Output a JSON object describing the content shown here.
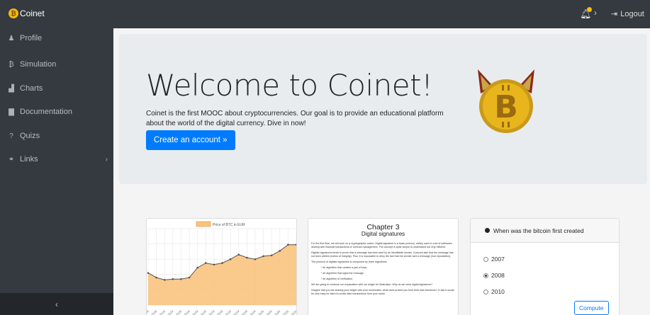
{
  "topbar": {
    "brand": "Coinet",
    "logout_label": "Logout",
    "icons": {
      "brand": "bitcoin-cat-logo",
      "bell": "bell-icon",
      "chevron": "chevron-right-icon",
      "logout": "sign-out-icon"
    },
    "notification_color": "#f2c200"
  },
  "sidebar": {
    "items": [
      {
        "label": "Profile",
        "icon": "user-icon",
        "glyph": "♟"
      },
      {
        "label": "Simulation",
        "icon": "bitcoin-icon",
        "glyph": "₿"
      },
      {
        "label": "Charts",
        "icon": "area-chart-icon",
        "glyph": "▟"
      },
      {
        "label": "Documentation",
        "icon": "file-icon",
        "glyph": "▇"
      },
      {
        "label": "Quizs",
        "icon": "question-icon",
        "glyph": "?"
      },
      {
        "label": "Links",
        "icon": "link-icon",
        "glyph": "⚭"
      }
    ],
    "collapse_glyph": "‹"
  },
  "jumbotron": {
    "title": "Welcome to Coinet!",
    "lead": "Coinet is the first MOOC about cryptocurrencies. Our goal is to provide an educational platform about the world of the digital currency. Dive in now!",
    "button_label": "Create an account »",
    "accent": "#007bff"
  },
  "chart_card": {
    "chart_data": {
      "type": "area",
      "title": "",
      "legend": [
        "Price of BTC in EUR"
      ],
      "series": [
        {
          "name": "Price of BTC in EUR",
          "values": [
            4.2,
            3.6,
            3.3,
            3.4,
            3.4,
            3.6,
            4.9,
            5.5,
            5.3,
            5.5,
            6.0,
            6.6,
            6.2,
            6.0,
            6.4,
            6.5,
            7.1,
            7.9,
            7.9
          ]
        }
      ],
      "x": [
        "11.2018",
        "12.2018",
        "1.2019",
        "2.2019",
        "3.2019",
        "4.2019",
        "5.2019",
        "6.2019",
        "7.2019",
        "8.2019",
        "9.2019",
        "10.2019",
        "11.2019",
        "12.2019",
        "1.2020",
        "2.2020",
        "3.2020",
        "4.2020",
        "5.2020"
      ],
      "ylim": [
        0,
        10
      ],
      "fill": "#f9c37f",
      "line": "#555555",
      "grid": true,
      "legend_position": "top-center"
    }
  },
  "doc_card": {
    "chapter": "Chapter 3",
    "subtitle": "Digital signatures",
    "paragraphs": [
      "For the first time, we will work on a cryptographic notion. Digital signature is a basic protocol, widely used in a lot of softwares dealing with financial transactions or contract management. The concept is quite simple to understand but very efficient.",
      "Digitals signatures tends to prove that a message has been sent by an identifiable sender, it proves also that the message has not been altered (notion of integrity). Plus, it is impossible to deny the fact that the sender sent a message (non repudiation).",
      "The protocol of digitals signatures is composed by three algorithms:",
      "* an algorithm that creates a pair of keys",
      "* an algorithm that signs the message",
      "* an algorithm of verification",
      "We are going to continue our explanation with our ledger for illustration. Why do we need digital signatures?",
      "Imagine that you are sharing your ledger with your roommates, what does protect you from their bad intentions? In fact it would be very easy for them to create fake transactions from your name."
    ]
  },
  "quiz_card": {
    "question": "When was the bitcoin first created",
    "options": [
      "2007",
      "2008",
      "2010"
    ],
    "selected": "2008",
    "button_label": "Compute"
  }
}
